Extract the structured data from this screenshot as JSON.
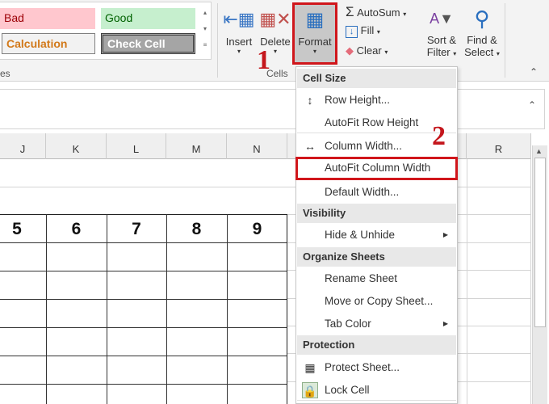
{
  "ribbon": {
    "styles": {
      "bad": "Bad",
      "good": "Good",
      "calculation": "Calculation",
      "check_cell": "Check Cell",
      "group_label": "es"
    },
    "cells": {
      "insert": "Insert",
      "delete": "Delete",
      "format": "Format",
      "group_label": "Cells"
    },
    "editing": {
      "autosum": "AutoSum",
      "fill": "Fill",
      "clear": "Clear",
      "sort_filter_1": "Sort &",
      "sort_filter_2": "Filter",
      "find_select_1": "Find &",
      "find_select_2": "Select"
    }
  },
  "grid": {
    "columns": [
      "J",
      "K",
      "L",
      "M",
      "N",
      "R"
    ],
    "row_values": [
      "5",
      "6",
      "7",
      "8",
      "9"
    ]
  },
  "menu": {
    "sections": [
      {
        "header": "Cell Size",
        "items": [
          "Row Height...",
          "AutoFit Row Height",
          "Column Width...",
          "AutoFit Column Width",
          "Default Width..."
        ]
      },
      {
        "header": "Visibility",
        "items": [
          "Hide & Unhide"
        ]
      },
      {
        "header": "Organize Sheets",
        "items": [
          "Rename Sheet",
          "Move or Copy Sheet...",
          "Tab Color"
        ]
      },
      {
        "header": "Protection",
        "items": [
          "Protect Sheet...",
          "Lock Cell"
        ]
      }
    ]
  },
  "callouts": {
    "step1": "1",
    "step2": "2"
  },
  "colors": {
    "highlight": "#d0161b",
    "bad_bg": "#ffc7ce",
    "good_bg": "#c6efce",
    "calc_text": "#d2791a"
  }
}
